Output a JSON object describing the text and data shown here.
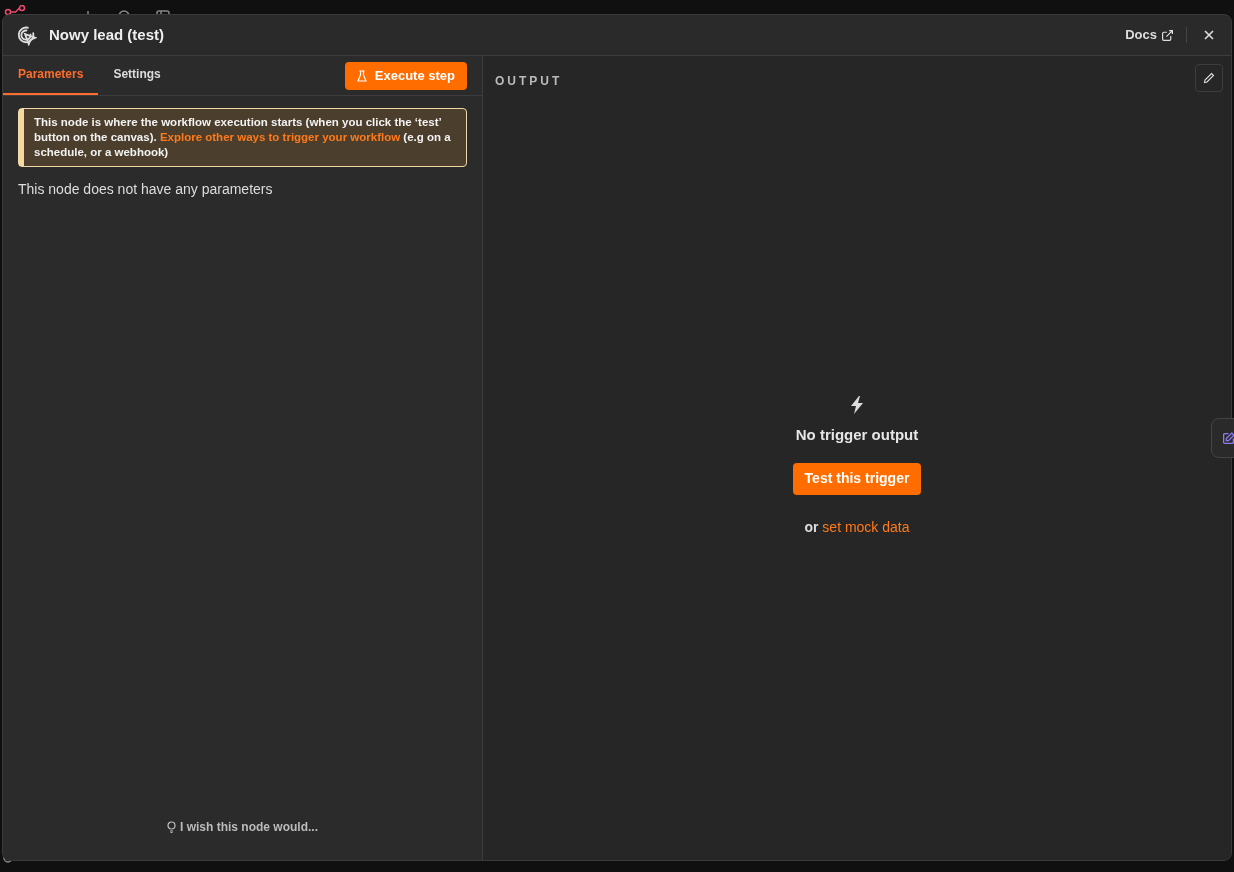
{
  "modal": {
    "title": "Nowy lead (test)",
    "docs_link": "Docs",
    "tabs": [
      {
        "label": "Parameters",
        "selected": true
      },
      {
        "label": "Settings",
        "selected": false
      }
    ],
    "execute_button": "Execute step",
    "notice": {
      "before": "This node is where the workflow execution starts (when you click the ‘test’ button on the canvas).",
      "link": "Explore other ways to trigger your workflow",
      "after": "(e.g on a schedule, or a webhook)"
    },
    "parameters_message": "This node does not have any parameters",
    "feedback_link": "I wish this node would...",
    "output": {
      "label": "OUTPUT",
      "empty_title": "No trigger output",
      "test_button": "Test this trigger",
      "alt_prefix": "or",
      "alt_link": "set mock data"
    }
  }
}
